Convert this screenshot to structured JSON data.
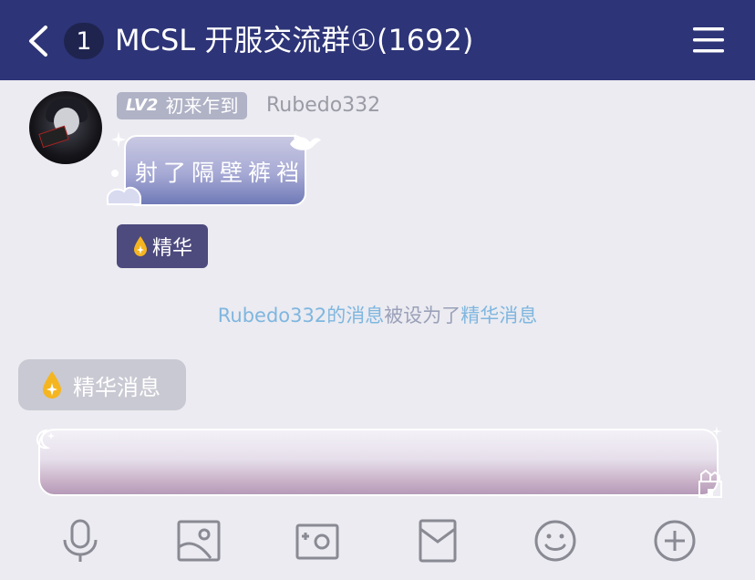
{
  "header": {
    "unread_count": "1",
    "title": "MCSL 开服交流群①(1692)"
  },
  "message": {
    "level": "LV2",
    "level_title": "初来乍到",
    "sender": "Rubedo332",
    "text": "射了隔壁裤裆",
    "featured_tag": "精华"
  },
  "system_notice": {
    "name": "Rubedo332",
    "part1": "的消息",
    "part2": "被设为了",
    "part3": "精华消息"
  },
  "featured_pill": {
    "label": "精华消息"
  },
  "colors": {
    "header_bg": "#2d3477",
    "background": "#ebebf1",
    "featured_tag_bg": "#4d4a7d",
    "notice_highlight": "#7fb6df",
    "drop_gold": "#f5b520"
  },
  "toolbar": {
    "icons": [
      "microphone-icon",
      "image-icon",
      "camera-icon",
      "red-packet-icon",
      "emoji-icon",
      "plus-icon"
    ]
  }
}
